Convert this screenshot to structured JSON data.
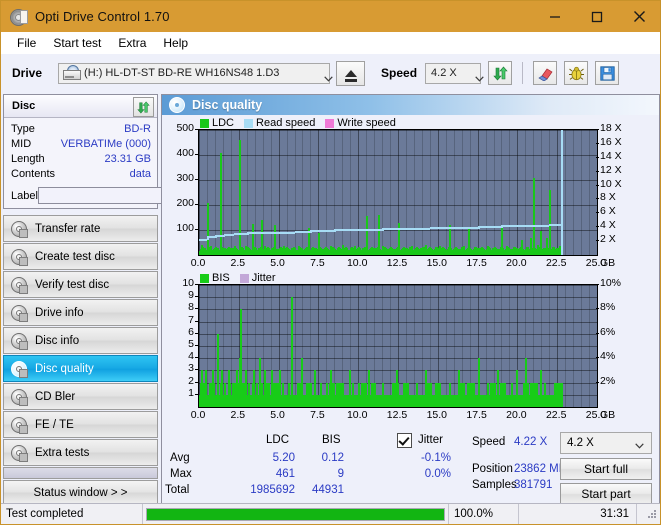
{
  "window": {
    "title": "Opti Drive Control 1.70",
    "icon": "disc-icon",
    "minimize": "─",
    "maximize": "□",
    "close": "✕"
  },
  "menu": {
    "items": [
      {
        "label": "File"
      },
      {
        "label": "Start test"
      },
      {
        "label": "Extra"
      },
      {
        "label": "Help"
      }
    ]
  },
  "toolbar": {
    "drive_label": "Drive",
    "drive_value": "(H:)  HL-DT-ST BD-RE  WH16NS48 1.D3",
    "eject_icon": "eject-icon",
    "speed_label": "Speed",
    "speed_value": "4.2 X",
    "refresh_icon": "refresh-icon",
    "erase_icon": "eraser-icon",
    "bug_icon": "bug-icon",
    "save_icon": "save-icon"
  },
  "disc_panel": {
    "title": "Disc",
    "refresh_icon": "refresh-icon",
    "rows": [
      {
        "key": "Type",
        "value": "BD-R"
      },
      {
        "key": "MID",
        "value": "VERBATIMe (000)"
      },
      {
        "key": "Length",
        "value": "23.31 GB"
      },
      {
        "key": "Contents",
        "value": "data"
      }
    ],
    "label_key": "Label",
    "label_value": "",
    "label_placeholder": "",
    "label_button_icon": "disc-icon"
  },
  "sidebar": {
    "items": [
      {
        "label": "Transfer rate",
        "icon": "disc-icon",
        "selected": false
      },
      {
        "label": "Create test disc",
        "icon": "disc-icon",
        "selected": false
      },
      {
        "label": "Verify test disc",
        "icon": "disc-icon",
        "selected": false
      },
      {
        "label": "Drive info",
        "icon": "disc-icon",
        "selected": false
      },
      {
        "label": "Disc info",
        "icon": "disc-icon",
        "selected": false
      },
      {
        "label": "Disc quality",
        "icon": "disc-icon",
        "selected": true
      },
      {
        "label": "CD Bler",
        "icon": "disc-icon",
        "selected": false
      },
      {
        "label": "FE / TE",
        "icon": "disc-icon",
        "selected": false
      },
      {
        "label": "Extra tests",
        "icon": "disc-icon",
        "selected": false
      }
    ],
    "status_window": "Status window > >"
  },
  "content": {
    "title": "Disc quality",
    "icon": "disc-icon"
  },
  "stats": {
    "col_ldc": "LDC",
    "col_bis": "BIS",
    "jitter_label": "Jitter",
    "jitter_checked": true,
    "rows": [
      {
        "key": "Avg",
        "ldc": "5.20",
        "bis": "0.12",
        "jitter": "-0.1%"
      },
      {
        "key": "Max",
        "ldc": "461",
        "bis": "9",
        "jitter": "0.0%"
      },
      {
        "key": "Total",
        "ldc": "1985692",
        "bis": "44931",
        "jitter": ""
      }
    ],
    "speed_key": "Speed",
    "speed_value": "4.22 X",
    "position_key": "Position",
    "position_value": "23862 MB",
    "samples_key": "Samples",
    "samples_value": "381791",
    "speed_select": "4.2 X",
    "start_full": "Start full",
    "start_part": "Start part"
  },
  "statusbar": {
    "text": "Test completed",
    "percent": "100.0%",
    "progress": 100,
    "time": "31:31"
  },
  "colors": {
    "titlebar": "#d89b33",
    "accent": "#16a8e4",
    "ldc": "#19c819",
    "bis": "#18cc18",
    "read_speed": "#a7dcf5",
    "write_speed": "#f07ad6",
    "jitter": "#c3a8d8",
    "plot_bg": "#6b7a99",
    "value_text": "#2b3bc4",
    "progress": "#12b512"
  },
  "chart_data": [
    {
      "type": "bar",
      "id": "disc-quality-ldc",
      "title": "",
      "xlabel": "GB",
      "ylabel": "",
      "xlim": [
        0,
        25
      ],
      "ylim": [
        0,
        500
      ],
      "y2lim": [
        0,
        18
      ],
      "y2label": "X",
      "grid": true,
      "legend_position": "top-left",
      "legend": [
        "LDC",
        "Read speed",
        "Write speed"
      ],
      "xticks": [
        "0.0",
        "2.5",
        "5.0",
        "7.5",
        "10.0",
        "12.5",
        "15.0",
        "17.5",
        "20.0",
        "22.5",
        "25.0"
      ],
      "yticks": [
        500,
        400,
        300,
        200,
        100
      ],
      "y2ticks": [
        "18 X",
        "16 X",
        "14 X",
        "12 X",
        "10 X",
        "8 X",
        "6 X",
        "4 X",
        "2 X"
      ],
      "xunit": "GB",
      "series": [
        {
          "name": "LDC",
          "type": "bar",
          "color": "#19c819",
          "x": [
            0.12,
            0.3,
            0.5,
            0.72,
            0.95,
            1.15,
            1.35,
            1.55,
            1.78,
            2.0,
            2.2,
            2.35,
            2.5,
            2.52,
            2.7,
            2.9,
            3.1,
            3.3,
            3.5,
            3.7,
            3.9,
            4.1,
            4.3,
            4.5,
            4.7,
            4.9,
            5.1,
            5.3,
            5.5,
            5.75,
            5.95,
            6.2,
            6.4,
            6.6,
            6.85,
            7.05,
            7.3,
            7.5,
            7.75,
            8.0,
            8.25,
            8.5,
            8.75,
            9.0,
            9.25,
            9.5,
            9.75,
            10.0,
            10.25,
            10.5,
            10.75,
            11.0,
            11.25,
            11.5,
            11.75,
            12.0,
            12.25,
            12.5,
            12.75,
            13.0,
            13.3,
            13.6,
            13.9,
            14.2,
            14.5,
            14.8,
            15.1,
            15.4,
            15.7,
            16.0,
            16.3,
            16.6,
            16.9,
            17.2,
            17.5,
            17.8,
            18.1,
            18.4,
            18.7,
            19.0,
            19.3,
            19.6,
            19.9,
            20.2,
            20.5,
            20.8,
            21.0,
            21.2,
            21.4,
            21.6,
            21.8,
            22.0,
            22.2,
            22.4,
            22.6,
            22.75
          ],
          "values": [
            40,
            30,
            210,
            35,
            25,
            30,
            408,
            30,
            25,
            30,
            35,
            25,
            462,
            30,
            25,
            35,
            30,
            125,
            25,
            30,
            140,
            35,
            25,
            30,
            120,
            25,
            30,
            35,
            25,
            30,
            25,
            35,
            30,
            25,
            110,
            25,
            30,
            90,
            25,
            30,
            35,
            25,
            30,
            40,
            25,
            30,
            35,
            25,
            30,
            155,
            25,
            30,
            160,
            35,
            25,
            30,
            25,
            130,
            25,
            30,
            35,
            25,
            30,
            40,
            25,
            30,
            35,
            25,
            120,
            30,
            25,
            35,
            105,
            25,
            30,
            25,
            35,
            30,
            25,
            110,
            35,
            25,
            30,
            60,
            25,
            70,
            310,
            40,
            95,
            30,
            70,
            260,
            25,
            30,
            35,
            25
          ]
        },
        {
          "name": "Read speed",
          "type": "line",
          "color": "#a7dcf5",
          "axis": "y2",
          "x": [
            0.0,
            0.5,
            1.0,
            1.6,
            2.2,
            3.0,
            4.0,
            5.0,
            6.0,
            7.0,
            8.5,
            10.0,
            11.5,
            13.0,
            14.5,
            16.0,
            17.5,
            19.0,
            20.5,
            22.0,
            22.7,
            22.75
          ],
          "values": [
            2.1,
            2.6,
            2.8,
            3.0,
            3.1,
            3.2,
            3.3,
            3.35,
            3.4,
            3.5,
            3.6,
            3.75,
            3.8,
            3.9,
            4.0,
            4.05,
            4.1,
            4.2,
            4.3,
            4.4,
            4.45,
            18.0
          ]
        },
        {
          "name": "Write speed",
          "type": "line",
          "color": "#f07ad6",
          "axis": "y2",
          "x": [],
          "values": []
        }
      ]
    },
    {
      "type": "bar",
      "id": "disc-quality-bis",
      "title": "",
      "xlabel": "GB",
      "ylabel": "",
      "xlim": [
        0,
        25
      ],
      "ylim": [
        0,
        10
      ],
      "y2lim": [
        0,
        10
      ],
      "y2label": "%",
      "grid": true,
      "legend_position": "top-left",
      "legend": [
        "BIS",
        "Jitter"
      ],
      "xticks": [
        "0.0",
        "2.5",
        "5.0",
        "7.5",
        "10.0",
        "12.5",
        "15.0",
        "17.5",
        "20.0",
        "22.5",
        "25.0"
      ],
      "yticks": [
        10,
        9,
        8,
        7,
        6,
        5,
        4,
        3,
        2,
        1
      ],
      "y2ticks": [
        "10%",
        "8%",
        "6%",
        "4%",
        "2%"
      ],
      "xunit": "GB",
      "series": [
        {
          "name": "BIS",
          "type": "bar",
          "color": "#18cc18",
          "x": [
            0.1,
            0.2,
            0.3,
            0.4,
            0.5,
            0.6,
            0.7,
            0.8,
            0.9,
            1.0,
            1.1,
            1.2,
            1.3,
            1.4,
            1.5,
            1.6,
            1.7,
            1.8,
            1.9,
            2.0,
            2.1,
            2.2,
            2.3,
            2.4,
            2.5,
            2.6,
            2.7,
            2.8,
            2.9,
            3.0,
            3.1,
            3.2,
            3.3,
            3.4,
            3.5,
            3.6,
            3.7,
            3.8,
            3.9,
            4.0,
            4.1,
            4.2,
            4.3,
            4.4,
            4.5,
            4.6,
            4.7,
            4.8,
            4.9,
            5.0,
            5.2,
            5.4,
            5.6,
            5.8,
            6.0,
            6.2,
            6.4,
            6.6,
            6.8,
            7.0,
            7.2,
            7.4,
            7.6,
            7.8,
            8.0,
            8.2,
            8.4,
            8.6,
            8.8,
            9.0,
            9.2,
            9.4,
            9.6,
            9.8,
            10.0,
            10.3,
            10.6,
            10.9,
            11.2,
            11.5,
            11.8,
            12.1,
            12.4,
            12.7,
            13.0,
            13.3,
            13.6,
            13.9,
            14.2,
            14.5,
            14.8,
            15.1,
            15.4,
            15.7,
            16.0,
            16.3,
            16.6,
            16.9,
            17.2,
            17.5,
            17.8,
            18.1,
            18.4,
            18.7,
            19.0,
            19.3,
            19.6,
            19.9,
            20.2,
            20.5,
            20.8,
            21.1,
            21.4,
            21.7,
            22.0,
            22.3,
            22.6,
            22.75
          ],
          "values": [
            3,
            1,
            2,
            3,
            1,
            2,
            1,
            3,
            2,
            1,
            6,
            1,
            2,
            3,
            1,
            2,
            1,
            3,
            2,
            1,
            2,
            1,
            3,
            2,
            4,
            8,
            2,
            1,
            3,
            1,
            2,
            1,
            2,
            3,
            1,
            2,
            1,
            4,
            2,
            1,
            3,
            1,
            2,
            1,
            3,
            2,
            1,
            2,
            1,
            3,
            2,
            1,
            2,
            9,
            1,
            2,
            4,
            1,
            2,
            1,
            3,
            1,
            2,
            1,
            2,
            3,
            1,
            2,
            1,
            2,
            1,
            3,
            2,
            1,
            2,
            1,
            3,
            2,
            1,
            2,
            1,
            2,
            3,
            1,
            2,
            1,
            2,
            1,
            3,
            2,
            1,
            2,
            1,
            2,
            1,
            3,
            2,
            1,
            2,
            4,
            1,
            2,
            1,
            3,
            2,
            1,
            2,
            3,
            1,
            4,
            2,
            1,
            3,
            2,
            1,
            2,
            1,
            2
          ]
        },
        {
          "name": "Jitter",
          "type": "line",
          "color": "#c3a8d8",
          "axis": "y2",
          "x": [],
          "values": []
        }
      ]
    }
  ]
}
